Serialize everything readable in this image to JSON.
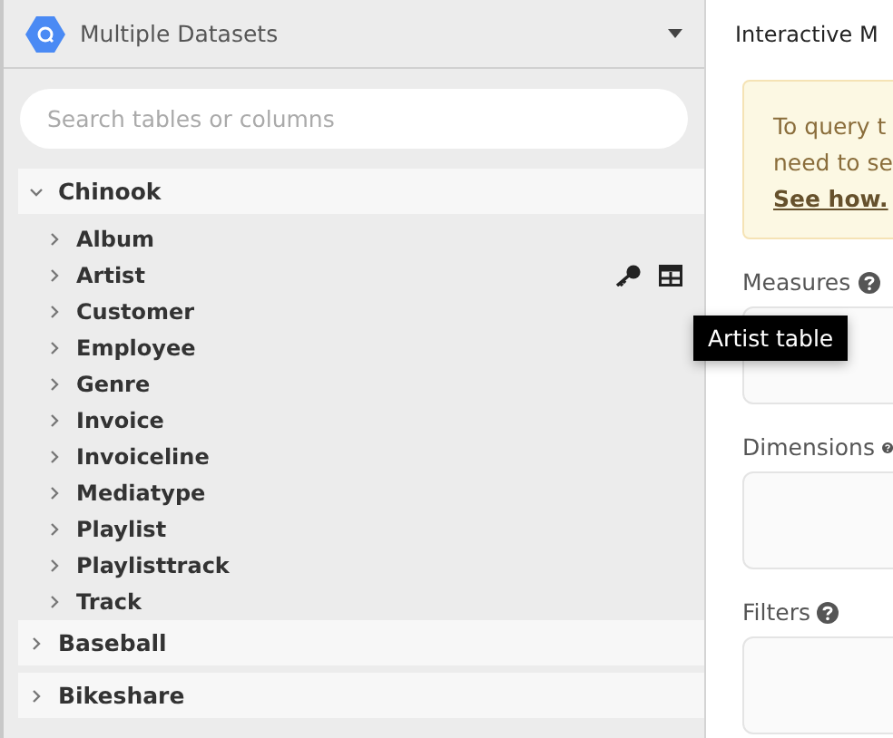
{
  "header": {
    "title": "Multiple Datasets"
  },
  "search": {
    "placeholder": "Search tables or columns"
  },
  "datasets": [
    {
      "name": "Chinook",
      "expanded": true,
      "children": [
        {
          "name": "Album",
          "expanded": false,
          "show_actions": false
        },
        {
          "name": "Artist",
          "expanded": false,
          "show_actions": true
        },
        {
          "name": "Customer",
          "expanded": false,
          "show_actions": false
        },
        {
          "name": "Employee",
          "expanded": false,
          "show_actions": false
        },
        {
          "name": "Genre",
          "expanded": false,
          "show_actions": false
        },
        {
          "name": "Invoice",
          "expanded": false,
          "show_actions": false
        },
        {
          "name": "Invoiceline",
          "expanded": false,
          "show_actions": false
        },
        {
          "name": "Mediatype",
          "expanded": false,
          "show_actions": false
        },
        {
          "name": "Playlist",
          "expanded": false,
          "show_actions": false
        },
        {
          "name": "Playlisttrack",
          "expanded": false,
          "show_actions": false
        },
        {
          "name": "Track",
          "expanded": false,
          "show_actions": false
        }
      ]
    },
    {
      "name": "Baseball",
      "expanded": false
    },
    {
      "name": "Bikeshare",
      "expanded": false
    }
  ],
  "tooltip": {
    "text": "Artist table"
  },
  "main": {
    "tab": "Interactive M",
    "notice": {
      "lines": [
        "To query t",
        "need to se"
      ],
      "link": "See how."
    },
    "sections": [
      {
        "label": "Measures"
      },
      {
        "label": "Dimensions"
      },
      {
        "label": "Filters"
      }
    ]
  }
}
